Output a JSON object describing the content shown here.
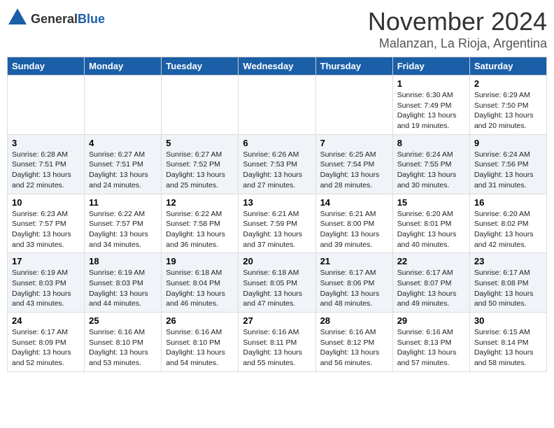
{
  "header": {
    "logo_general": "General",
    "logo_blue": "Blue",
    "month_title": "November 2024",
    "location": "Malanzan, La Rioja, Argentina"
  },
  "weekdays": [
    "Sunday",
    "Monday",
    "Tuesday",
    "Wednesday",
    "Thursday",
    "Friday",
    "Saturday"
  ],
  "weeks": [
    [
      {
        "day": "",
        "info": ""
      },
      {
        "day": "",
        "info": ""
      },
      {
        "day": "",
        "info": ""
      },
      {
        "day": "",
        "info": ""
      },
      {
        "day": "",
        "info": ""
      },
      {
        "day": "1",
        "info": "Sunrise: 6:30 AM\nSunset: 7:49 PM\nDaylight: 13 hours\nand 19 minutes."
      },
      {
        "day": "2",
        "info": "Sunrise: 6:29 AM\nSunset: 7:50 PM\nDaylight: 13 hours\nand 20 minutes."
      }
    ],
    [
      {
        "day": "3",
        "info": "Sunrise: 6:28 AM\nSunset: 7:51 PM\nDaylight: 13 hours\nand 22 minutes."
      },
      {
        "day": "4",
        "info": "Sunrise: 6:27 AM\nSunset: 7:51 PM\nDaylight: 13 hours\nand 24 minutes."
      },
      {
        "day": "5",
        "info": "Sunrise: 6:27 AM\nSunset: 7:52 PM\nDaylight: 13 hours\nand 25 minutes."
      },
      {
        "day": "6",
        "info": "Sunrise: 6:26 AM\nSunset: 7:53 PM\nDaylight: 13 hours\nand 27 minutes."
      },
      {
        "day": "7",
        "info": "Sunrise: 6:25 AM\nSunset: 7:54 PM\nDaylight: 13 hours\nand 28 minutes."
      },
      {
        "day": "8",
        "info": "Sunrise: 6:24 AM\nSunset: 7:55 PM\nDaylight: 13 hours\nand 30 minutes."
      },
      {
        "day": "9",
        "info": "Sunrise: 6:24 AM\nSunset: 7:56 PM\nDaylight: 13 hours\nand 31 minutes."
      }
    ],
    [
      {
        "day": "10",
        "info": "Sunrise: 6:23 AM\nSunset: 7:57 PM\nDaylight: 13 hours\nand 33 minutes."
      },
      {
        "day": "11",
        "info": "Sunrise: 6:22 AM\nSunset: 7:57 PM\nDaylight: 13 hours\nand 34 minutes."
      },
      {
        "day": "12",
        "info": "Sunrise: 6:22 AM\nSunset: 7:58 PM\nDaylight: 13 hours\nand 36 minutes."
      },
      {
        "day": "13",
        "info": "Sunrise: 6:21 AM\nSunset: 7:59 PM\nDaylight: 13 hours\nand 37 minutes."
      },
      {
        "day": "14",
        "info": "Sunrise: 6:21 AM\nSunset: 8:00 PM\nDaylight: 13 hours\nand 39 minutes."
      },
      {
        "day": "15",
        "info": "Sunrise: 6:20 AM\nSunset: 8:01 PM\nDaylight: 13 hours\nand 40 minutes."
      },
      {
        "day": "16",
        "info": "Sunrise: 6:20 AM\nSunset: 8:02 PM\nDaylight: 13 hours\nand 42 minutes."
      }
    ],
    [
      {
        "day": "17",
        "info": "Sunrise: 6:19 AM\nSunset: 8:03 PM\nDaylight: 13 hours\nand 43 minutes."
      },
      {
        "day": "18",
        "info": "Sunrise: 6:19 AM\nSunset: 8:03 PM\nDaylight: 13 hours\nand 44 minutes."
      },
      {
        "day": "19",
        "info": "Sunrise: 6:18 AM\nSunset: 8:04 PM\nDaylight: 13 hours\nand 46 minutes."
      },
      {
        "day": "20",
        "info": "Sunrise: 6:18 AM\nSunset: 8:05 PM\nDaylight: 13 hours\nand 47 minutes."
      },
      {
        "day": "21",
        "info": "Sunrise: 6:17 AM\nSunset: 8:06 PM\nDaylight: 13 hours\nand 48 minutes."
      },
      {
        "day": "22",
        "info": "Sunrise: 6:17 AM\nSunset: 8:07 PM\nDaylight: 13 hours\nand 49 minutes."
      },
      {
        "day": "23",
        "info": "Sunrise: 6:17 AM\nSunset: 8:08 PM\nDaylight: 13 hours\nand 50 minutes."
      }
    ],
    [
      {
        "day": "24",
        "info": "Sunrise: 6:17 AM\nSunset: 8:09 PM\nDaylight: 13 hours\nand 52 minutes."
      },
      {
        "day": "25",
        "info": "Sunrise: 6:16 AM\nSunset: 8:10 PM\nDaylight: 13 hours\nand 53 minutes."
      },
      {
        "day": "26",
        "info": "Sunrise: 6:16 AM\nSunset: 8:10 PM\nDaylight: 13 hours\nand 54 minutes."
      },
      {
        "day": "27",
        "info": "Sunrise: 6:16 AM\nSunset: 8:11 PM\nDaylight: 13 hours\nand 55 minutes."
      },
      {
        "day": "28",
        "info": "Sunrise: 6:16 AM\nSunset: 8:12 PM\nDaylight: 13 hours\nand 56 minutes."
      },
      {
        "day": "29",
        "info": "Sunrise: 6:16 AM\nSunset: 8:13 PM\nDaylight: 13 hours\nand 57 minutes."
      },
      {
        "day": "30",
        "info": "Sunrise: 6:15 AM\nSunset: 8:14 PM\nDaylight: 13 hours\nand 58 minutes."
      }
    ]
  ]
}
